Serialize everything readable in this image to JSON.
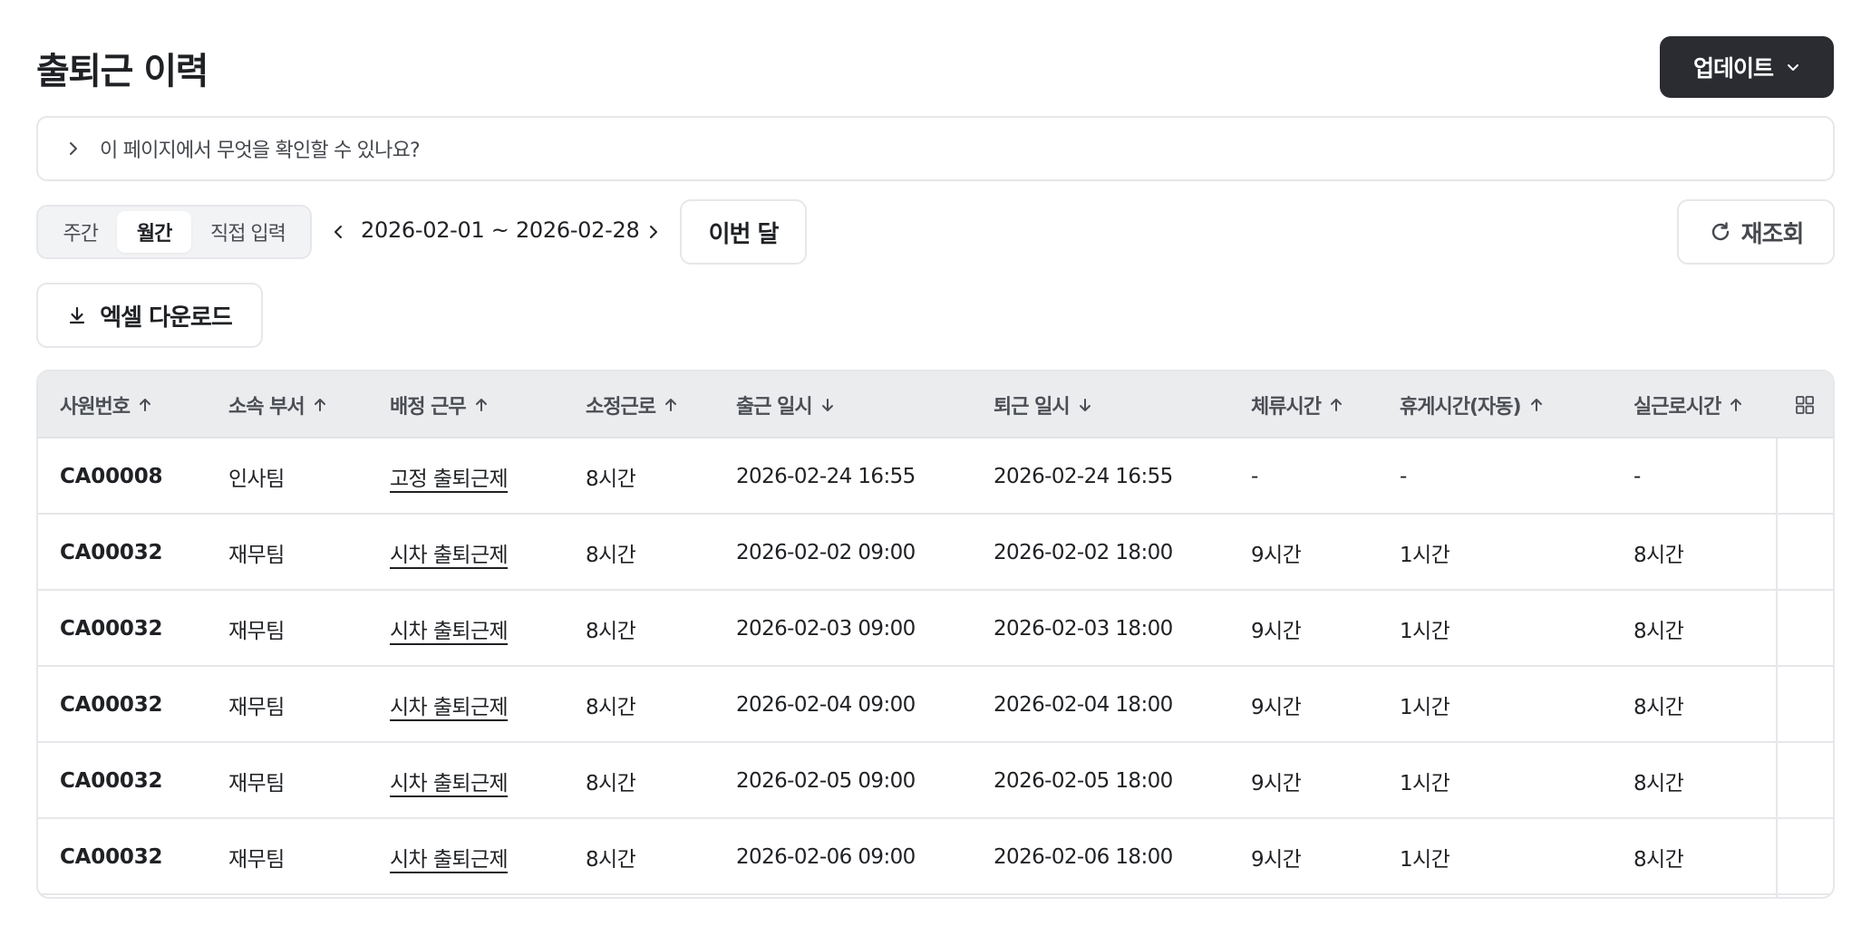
{
  "header": {
    "title": "출퇴근 이력",
    "update_label": "업데이트"
  },
  "help": {
    "text": "이 페이지에서 무엇을 확인할 수 있나요?"
  },
  "period_tabs": [
    {
      "label": "주간",
      "selected": false
    },
    {
      "label": "월간",
      "selected": true
    },
    {
      "label": "직접 입력",
      "selected": false
    }
  ],
  "date_range": "2026-02-01 ~ 2026-02-28",
  "this_month_label": "이번 달",
  "refresh_label": "재조회",
  "excel_label": "엑셀 다운로드",
  "table": {
    "columns": [
      {
        "label": "사원번호",
        "sort": "asc"
      },
      {
        "label": "소속 부서",
        "sort": "asc"
      },
      {
        "label": "배정 근무",
        "sort": "asc"
      },
      {
        "label": "소정근로",
        "sort": "asc"
      },
      {
        "label": "출근 일시",
        "sort": "desc"
      },
      {
        "label": "퇴근 일시",
        "sort": "desc"
      },
      {
        "label": "체류시간",
        "sort": "asc"
      },
      {
        "label": "휴게시간(자동)",
        "sort": "asc"
      },
      {
        "label": "실근로시간",
        "sort": "asc"
      }
    ],
    "rows": [
      [
        "CA00008",
        "인사팀",
        "고정 출퇴근제",
        "8시간",
        "2026-02-24 16:55",
        "2026-02-24 16:55",
        "-",
        "-",
        "-"
      ],
      [
        "CA00032",
        "재무팀",
        "시차 출퇴근제",
        "8시간",
        "2026-02-02 09:00",
        "2026-02-02 18:00",
        "9시간",
        "1시간",
        "8시간"
      ],
      [
        "CA00032",
        "재무팀",
        "시차 출퇴근제",
        "8시간",
        "2026-02-03 09:00",
        "2026-02-03 18:00",
        "9시간",
        "1시간",
        "8시간"
      ],
      [
        "CA00032",
        "재무팀",
        "시차 출퇴근제",
        "8시간",
        "2026-02-04 09:00",
        "2026-02-04 18:00",
        "9시간",
        "1시간",
        "8시간"
      ],
      [
        "CA00032",
        "재무팀",
        "시차 출퇴근제",
        "8시간",
        "2026-02-05 09:00",
        "2026-02-05 18:00",
        "9시간",
        "1시간",
        "8시간"
      ],
      [
        "CA00032",
        "재무팀",
        "시차 출퇴근제",
        "8시간",
        "2026-02-06 09:00",
        "2026-02-06 18:00",
        "9시간",
        "1시간",
        "8시간"
      ]
    ]
  },
  "icons": {
    "update_chevron": "chevron-down-icon",
    "help_chevron": "chevron-right-icon",
    "prev": "chevron-left-icon",
    "next": "chevron-right-icon",
    "refresh": "refresh-icon",
    "download": "download-icon",
    "sort_asc": "arrow-up-icon",
    "sort_desc": "arrow-down-icon",
    "columns": "grid-icon"
  },
  "colors": {
    "primary_button": "#2a2c31",
    "header_bg": "#ebecee",
    "border": "#e6e7ea"
  }
}
